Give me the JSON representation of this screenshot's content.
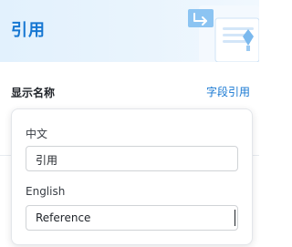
{
  "header": {
    "title": "引用"
  },
  "field": {
    "label": "显示名称",
    "link": "字段引用"
  },
  "popover": {
    "zh_label": "中文",
    "zh_value": "引用",
    "en_label": "English",
    "en_value": "Reference"
  },
  "colors": {
    "accent": "#1677d2",
    "header_bg": "#e6f2fd",
    "text_primary": "#1f2329",
    "border": "#d0d3d6"
  }
}
